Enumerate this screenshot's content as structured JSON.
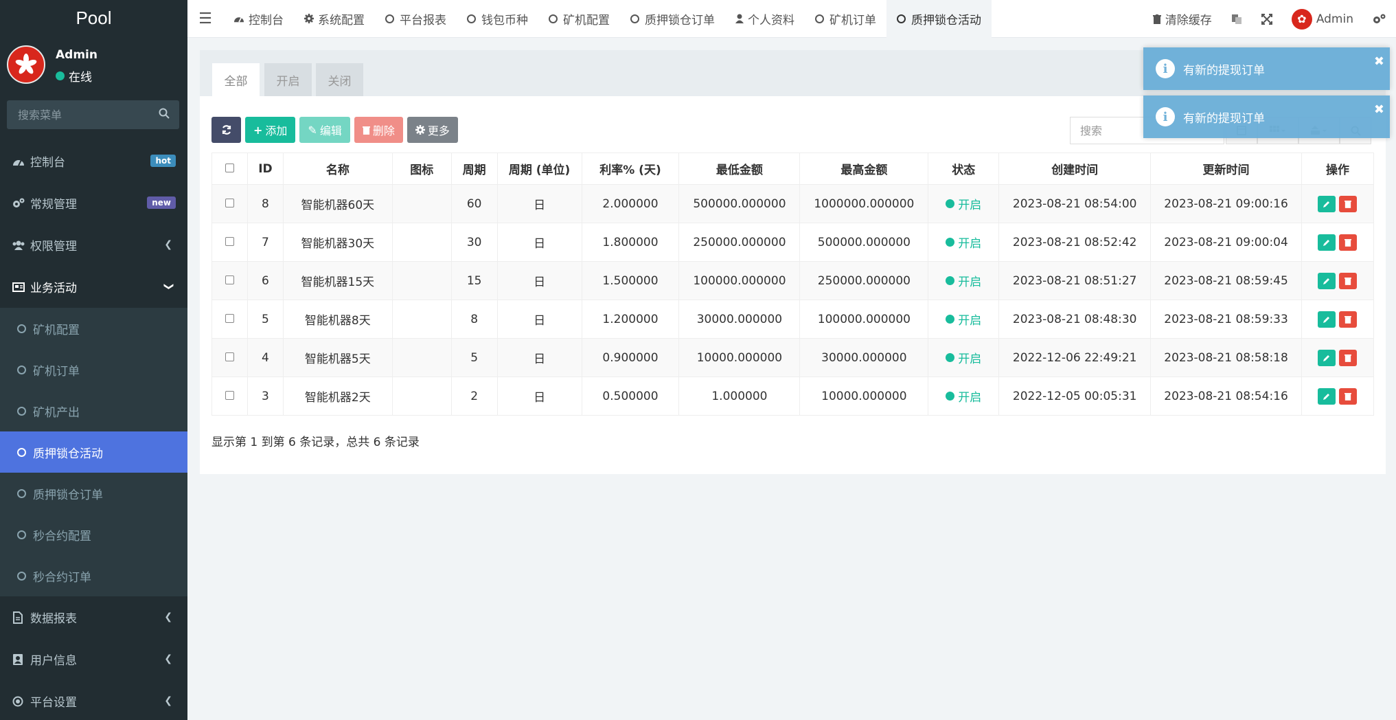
{
  "app": {
    "logo": "Pool"
  },
  "user": {
    "name": "Admin",
    "status": "在线"
  },
  "sidebar": {
    "search_placeholder": "搜索菜单",
    "items": [
      {
        "label": "控制台",
        "badge": "hot"
      },
      {
        "label": "常规管理",
        "badge": "new"
      },
      {
        "label": "权限管理"
      },
      {
        "label": "业务活动"
      }
    ],
    "subitems": [
      {
        "label": "矿机配置"
      },
      {
        "label": "矿机订单"
      },
      {
        "label": "矿机产出"
      },
      {
        "label": "质押锁仓活动"
      },
      {
        "label": "质押锁仓订单"
      },
      {
        "label": "秒合约配置"
      },
      {
        "label": "秒合约订单"
      }
    ],
    "bottom_items": [
      {
        "label": "数据报表"
      },
      {
        "label": "用户信息"
      },
      {
        "label": "平台设置"
      }
    ]
  },
  "topbar": {
    "tabs": [
      {
        "label": "控制台"
      },
      {
        "label": "系统配置"
      },
      {
        "label": "平台报表"
      },
      {
        "label": "钱包币种"
      },
      {
        "label": "矿机配置"
      },
      {
        "label": "质押锁仓订单"
      },
      {
        "label": "个人资料"
      },
      {
        "label": "矿机订单"
      },
      {
        "label": "质押锁仓活动"
      }
    ],
    "clear_cache": "清除缓存",
    "admin": "Admin"
  },
  "panel": {
    "tabs": [
      {
        "label": "全部"
      },
      {
        "label": "开启"
      },
      {
        "label": "关闭"
      }
    ],
    "buttons": {
      "add": "添加",
      "edit": "编辑",
      "delete": "删除",
      "more": "更多"
    },
    "search_placeholder": "搜索"
  },
  "table": {
    "headers": [
      "ID",
      "名称",
      "图标",
      "周期",
      "周期 (单位)",
      "利率% (天)",
      "最低金额",
      "最高金额",
      "状态",
      "创建时间",
      "更新时间",
      "操作"
    ],
    "rows": [
      {
        "id": "8",
        "name": "智能机器60天",
        "icon": "",
        "period": "60",
        "unit": "日",
        "rate": "2.000000",
        "min": "500000.000000",
        "max": "1000000.000000",
        "status": "开启",
        "created": "2023-08-21 08:54:00",
        "updated": "2023-08-21 09:00:16"
      },
      {
        "id": "7",
        "name": "智能机器30天",
        "icon": "",
        "period": "30",
        "unit": "日",
        "rate": "1.800000",
        "min": "250000.000000",
        "max": "500000.000000",
        "status": "开启",
        "created": "2023-08-21 08:52:42",
        "updated": "2023-08-21 09:00:04"
      },
      {
        "id": "6",
        "name": "智能机器15天",
        "icon": "",
        "period": "15",
        "unit": "日",
        "rate": "1.500000",
        "min": "100000.000000",
        "max": "250000.000000",
        "status": "开启",
        "created": "2023-08-21 08:51:27",
        "updated": "2023-08-21 08:59:45"
      },
      {
        "id": "5",
        "name": "智能机器8天",
        "icon": "",
        "period": "8",
        "unit": "日",
        "rate": "1.200000",
        "min": "30000.000000",
        "max": "100000.000000",
        "status": "开启",
        "created": "2023-08-21 08:48:30",
        "updated": "2023-08-21 08:59:33"
      },
      {
        "id": "4",
        "name": "智能机器5天",
        "icon": "",
        "period": "5",
        "unit": "日",
        "rate": "0.900000",
        "min": "10000.000000",
        "max": "30000.000000",
        "status": "开启",
        "created": "2022-12-06 22:49:21",
        "updated": "2023-08-21 08:58:18"
      },
      {
        "id": "3",
        "name": "智能机器2天",
        "icon": "",
        "period": "2",
        "unit": "日",
        "rate": "0.500000",
        "min": "1.000000",
        "max": "10000.000000",
        "status": "开启",
        "created": "2022-12-05 00:05:31",
        "updated": "2023-08-21 08:54:16"
      }
    ]
  },
  "pager": {
    "text": "显示第 1 到第 6 条记录，总共 6 条记录"
  },
  "toasts": [
    {
      "text": "有新的提现订单"
    },
    {
      "text": "有新的提现订单"
    }
  ],
  "colors": {
    "sidebar_bg": "#222d32",
    "active": "#4e73df",
    "green": "#18bc9c",
    "red": "#e74c3c",
    "toast": "#6aaed8"
  }
}
